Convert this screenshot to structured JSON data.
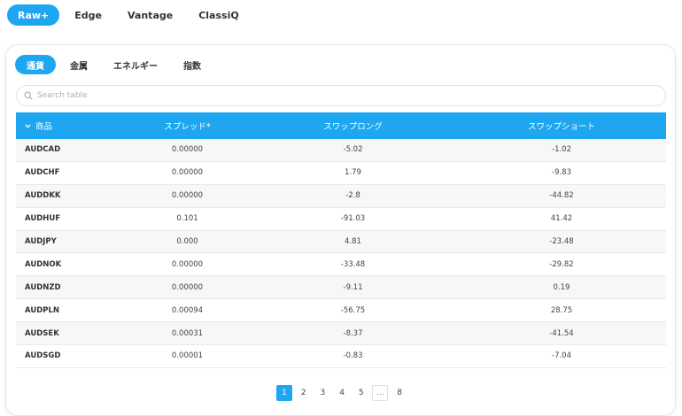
{
  "account_tabs": [
    "Raw+",
    "Edge",
    "Vantage",
    "ClassiQ"
  ],
  "category_tabs": [
    "通貨",
    "金属",
    "エネルギー",
    "指数"
  ],
  "search": {
    "placeholder": "Search table"
  },
  "table": {
    "headers": [
      "商品",
      "スプレッド*",
      "スワップロング",
      "スワップショート"
    ],
    "rows": [
      [
        "AUDCAD",
        "0.00000",
        "-5.02",
        "-1.02"
      ],
      [
        "AUDCHF",
        "0.00000",
        "1.79",
        "-9.83"
      ],
      [
        "AUDDKK",
        "0.00000",
        "-2.8",
        "-44.82"
      ],
      [
        "AUDHUF",
        "0.101",
        "-91.03",
        "41.42"
      ],
      [
        "AUDJPY",
        "0.000",
        "4.81",
        "-23.48"
      ],
      [
        "AUDNOK",
        "0.00000",
        "-33.48",
        "-29.82"
      ],
      [
        "AUDNZD",
        "0.00000",
        "-9.11",
        "0.19"
      ],
      [
        "AUDPLN",
        "0.00094",
        "-56.75",
        "28.75"
      ],
      [
        "AUDSEK",
        "0.00031",
        "-8.37",
        "-41.54"
      ],
      [
        "AUDSGD",
        "0.00001",
        "-0.83",
        "-7.04"
      ]
    ]
  },
  "pagination": {
    "pages": [
      "1",
      "2",
      "3",
      "4",
      "5"
    ],
    "ellipsis": "...",
    "last": "8",
    "current": "1"
  },
  "colors": {
    "accent": "#1ea7f0"
  },
  "icons": {
    "search": "search-icon",
    "sort": "chevron-down-icon"
  }
}
